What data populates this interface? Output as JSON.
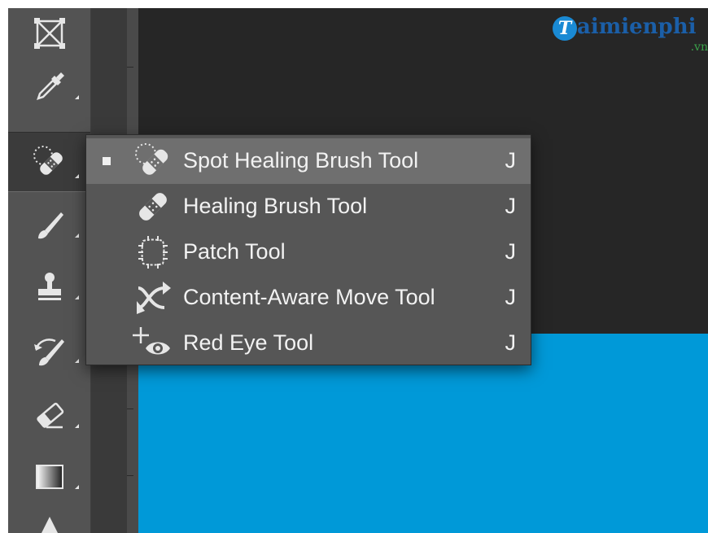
{
  "toolbar": {
    "tools": [
      {
        "name": "frame-tool",
        "icon": "frame-icon",
        "has_submenu": false
      },
      {
        "name": "eyedropper-tool",
        "icon": "eyedropper-icon",
        "has_submenu": true
      },
      {
        "name": "spot-healing-tool",
        "icon": "spot-healing-bandage-icon",
        "has_submenu": true,
        "active": true
      },
      {
        "name": "brush-tool",
        "icon": "brush-icon",
        "has_submenu": true
      },
      {
        "name": "clone-stamp-tool",
        "icon": "stamp-icon",
        "has_submenu": true
      },
      {
        "name": "history-brush-tool",
        "icon": "history-brush-icon",
        "has_submenu": true
      },
      {
        "name": "eraser-tool",
        "icon": "eraser-icon",
        "has_submenu": true
      },
      {
        "name": "gradient-tool",
        "icon": "gradient-icon",
        "has_submenu": true
      },
      {
        "name": "blur-tool",
        "icon": "blur-drop-icon",
        "has_submenu": false
      }
    ]
  },
  "menu": {
    "items": [
      {
        "label": "Spot Healing Brush Tool",
        "shortcut": "J",
        "icon": "spot-healing-bandage-icon",
        "selected": true
      },
      {
        "label": "Healing Brush Tool",
        "shortcut": "J",
        "icon": "healing-bandage-icon",
        "selected": false
      },
      {
        "label": "Patch Tool",
        "shortcut": "J",
        "icon": "patch-icon",
        "selected": false
      },
      {
        "label": "Content-Aware Move Tool",
        "shortcut": "J",
        "icon": "content-aware-move-icon",
        "selected": false
      },
      {
        "label": "Red Eye Tool",
        "shortcut": "J",
        "icon": "red-eye-icon",
        "selected": false
      }
    ]
  },
  "watermark": {
    "logo_letter": "T",
    "text": "aimienphi",
    "sub": ".vn"
  },
  "colors": {
    "toolbar_bg": "#535353",
    "menu_bg": "#565656",
    "menu_selected": "#6f6f6f",
    "canvas_dark": "#262626",
    "canvas_blue": "#0099d8",
    "watermark_blue": "#1b5fa8",
    "watermark_green": "#3aa34a"
  }
}
